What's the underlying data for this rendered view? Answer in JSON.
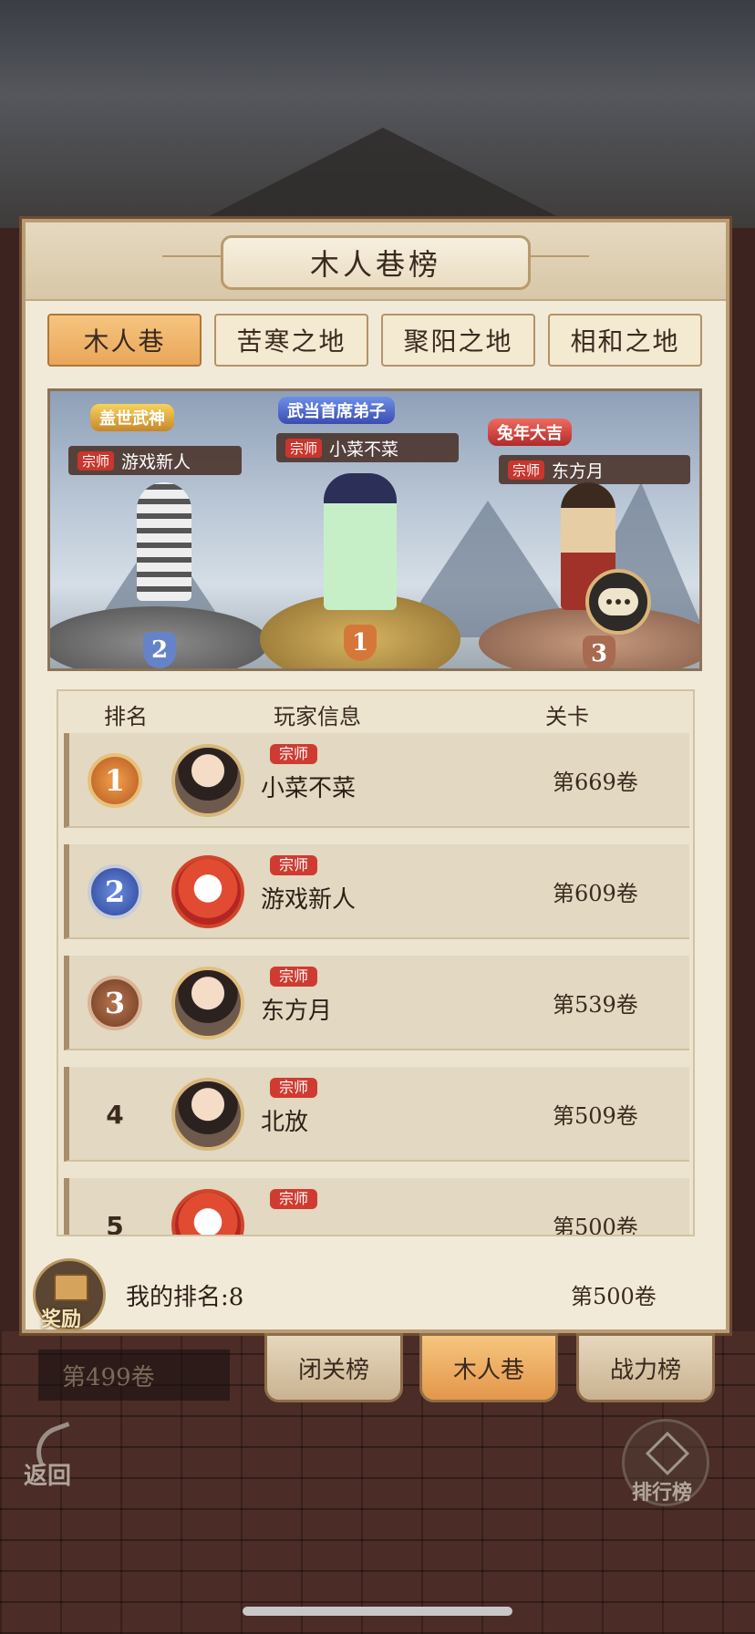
{
  "panel": {
    "title": "木人巷榜",
    "tabs": [
      {
        "label": "木人巷",
        "active": true
      },
      {
        "label": "苦寒之地",
        "active": false
      },
      {
        "label": "聚阳之地",
        "active": false
      },
      {
        "label": "相和之地",
        "active": false
      }
    ]
  },
  "podium": {
    "sect_label": "宗师",
    "second": {
      "title": "盖世武神",
      "name": "游戏新人",
      "rank": "2"
    },
    "first": {
      "title": "武当首席弟子",
      "name": "小菜不菜",
      "rank": "1"
    },
    "third": {
      "title": "兔年大吉",
      "name": "东方月",
      "rank": "3"
    }
  },
  "table": {
    "headers": {
      "rank": "排名",
      "info": "玩家信息",
      "stage": "关卡"
    },
    "rows": [
      {
        "rank": "1",
        "sect": "宗师",
        "name": "小菜不菜",
        "stage": "第669卷"
      },
      {
        "rank": "2",
        "sect": "宗师",
        "name": "游戏新人",
        "stage": "第609卷"
      },
      {
        "rank": "3",
        "sect": "宗师",
        "name": "东方月",
        "stage": "第539卷"
      },
      {
        "rank": "4",
        "sect": "宗师",
        "name": "北放",
        "stage": "第509卷"
      },
      {
        "rank": "5",
        "sect": "宗师",
        "name": "",
        "stage": "第500卷"
      }
    ]
  },
  "footer": {
    "reward_label": "奖励",
    "my_rank": "我的排名:8",
    "my_stage": "第500卷"
  },
  "behind_stage": "第499卷",
  "bottom_tabs": [
    {
      "label": "闭关榜",
      "active": false
    },
    {
      "label": "木人巷",
      "active": true
    },
    {
      "label": "战力榜",
      "active": false
    }
  ],
  "nav": {
    "back_label": "返回",
    "leaderboard_label": "排行榜"
  },
  "colors": {
    "accent_orange": "#e9a65a",
    "sect_red": "#cf3b30",
    "panel_bg": "#f2ead8"
  }
}
